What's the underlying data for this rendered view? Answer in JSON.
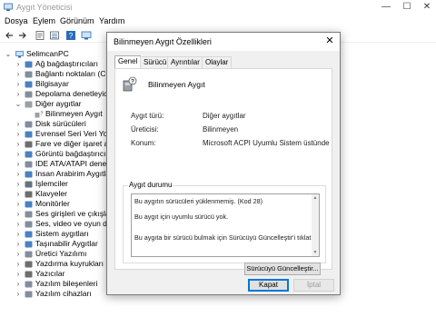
{
  "window": {
    "title": "Aygıt Yöneticisi",
    "controls": [
      "—",
      "☐",
      "✕"
    ]
  },
  "menu": [
    "Dosya",
    "Eylem",
    "Görünüm",
    "Yardım"
  ],
  "toolbar": [
    "back-icon",
    "forward-icon",
    "properties-icon",
    "list-icon",
    "help-icon",
    "monitor-icon"
  ],
  "tree": {
    "root": "SelimcanPC",
    "items": [
      {
        "label": "Ağ bağdaştırıcıları",
        "expanded": false
      },
      {
        "label": "Bağlantı noktaları (COM",
        "expanded": false
      },
      {
        "label": "Bilgisayar",
        "expanded": false
      },
      {
        "label": "Depolama denetleyiciler",
        "expanded": false
      },
      {
        "label": "Diğer aygıtlar",
        "expanded": true
      },
      {
        "label": "Bilinmeyen Aygıt",
        "child": true
      },
      {
        "label": "Disk sürücüleri",
        "expanded": false
      },
      {
        "label": "Evrensel Seri Veri Yolu de",
        "expanded": false
      },
      {
        "label": "Fare ve diğer işaret aygı",
        "expanded": false
      },
      {
        "label": "Görüntü bağdaştırıcıları",
        "expanded": false
      },
      {
        "label": "IDE ATA/ATAPI denetleyic",
        "expanded": false
      },
      {
        "label": "İnsan Arabirim Aygıtları",
        "expanded": false
      },
      {
        "label": "İşlemciler",
        "expanded": false
      },
      {
        "label": "Klavyeler",
        "expanded": false
      },
      {
        "label": "Monitörler",
        "expanded": false
      },
      {
        "label": "Ses girişleri ve çıkışları",
        "expanded": false
      },
      {
        "label": "Ses, video ve oyun den",
        "expanded": false
      },
      {
        "label": "Sistem aygıtları",
        "expanded": false
      },
      {
        "label": "Taşınabilir Aygıtlar",
        "expanded": false
      },
      {
        "label": "Üretici Yazılımı",
        "expanded": false
      },
      {
        "label": "Yazdırma kuyrukları",
        "expanded": false
      },
      {
        "label": "Yazıcılar",
        "expanded": false
      },
      {
        "label": "Yazılım bileşenleri",
        "expanded": false
      },
      {
        "label": "Yazılım cihazları",
        "expanded": false
      }
    ]
  },
  "dialog": {
    "title": "Bilinmeyen Aygıt Özellikleri",
    "close": "✕",
    "tabs": [
      "Genel",
      "Sürücü",
      "Ayrıntılar",
      "Olaylar"
    ],
    "active_tab": "Genel",
    "device_name": "Bilinmeyen Aygıt",
    "properties": [
      {
        "key": "Aygıt türü:",
        "value": "Diğer aygıtlar"
      },
      {
        "key": "Üreticisi:",
        "value": "Bilinmeyen"
      },
      {
        "key": "Konum:",
        "value": "Microsoft ACPI Uyumlu Sistem üstünde"
      }
    ],
    "status_group_label": "Aygıt durumu",
    "status_lines": [
      "Bu aygıtın sürücüleri yüklenmemiş. (Kod 28)",
      "Bu aygıt için uyumlu sürücü yok.",
      "Bu aygıta bir sürücü bulmak için Sürücüyü Güncelleştir'i tıklatın."
    ],
    "update_button": "Sürücüyü Güncelleştir...",
    "ok_button": "Kapat",
    "cancel_button": "İptal"
  }
}
